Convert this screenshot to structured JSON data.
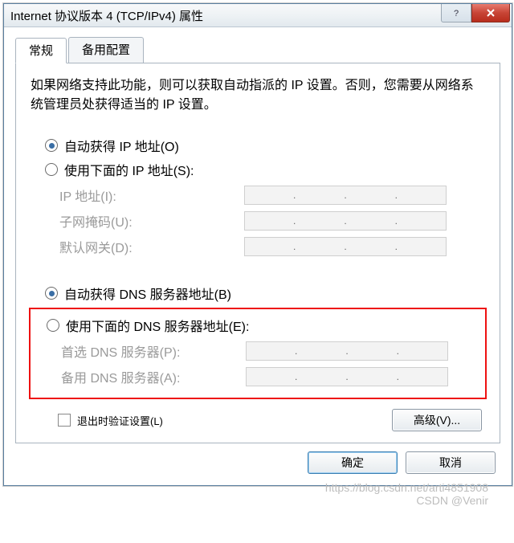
{
  "window": {
    "title": "Internet 协议版本 4 (TCP/IPv4) 属性"
  },
  "tabs": {
    "general": "常规",
    "alternate": "备用配置"
  },
  "description": "如果网络支持此功能，则可以获取自动指派的 IP 设置。否则，您需要从网络系统管理员处获得适当的 IP 设置。",
  "ip_section": {
    "auto_label": "自动获得 IP 地址(O)",
    "manual_label": "使用下面的 IP 地址(S):",
    "ip_label": "IP 地址(I):",
    "subnet_label": "子网掩码(U):",
    "gateway_label": "默认网关(D):"
  },
  "dns_section": {
    "auto_label": "自动获得 DNS 服务器地址(B)",
    "manual_label": "使用下面的 DNS 服务器地址(E):",
    "preferred_label": "首选 DNS 服务器(P):",
    "alternate_label": "备用 DNS 服务器(A):"
  },
  "validate_label": "退出时验证设置(L)",
  "buttons": {
    "advanced": "高级(V)...",
    "ok": "确定",
    "cancel": "取消"
  },
  "watermark": {
    "line1": "https://blog.csdn.net/arti4851908",
    "line2": "CSDN @Venir"
  }
}
